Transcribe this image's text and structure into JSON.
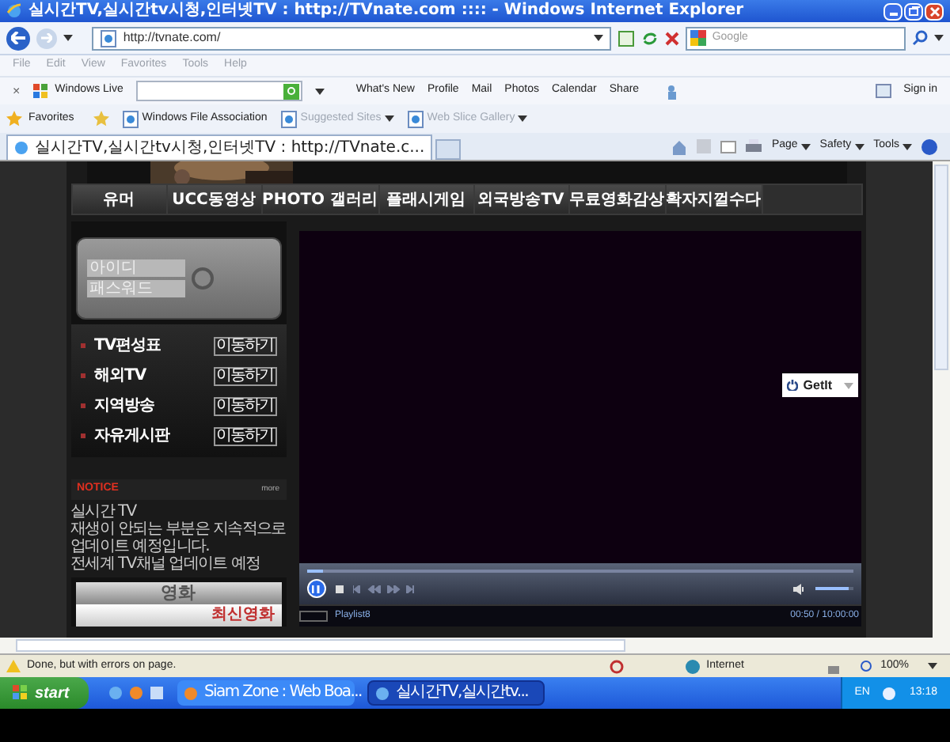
{
  "window": {
    "title": "실시간TV,실시간tv시청,인터넷TV : http://TVnate.com :::: - Windows Internet Explorer"
  },
  "address_bar": {
    "url": "http://tvnate.com/",
    "search_placeholder": "Google"
  },
  "menu_bar": [
    "File",
    "Edit",
    "View",
    "Favorites",
    "Tools",
    "Help"
  ],
  "live_toolbar": {
    "close": "×",
    "brand": "Windows Live",
    "links": [
      "What's New",
      "Profile",
      "Mail",
      "Photos",
      "Calendar",
      "Share"
    ],
    "sign_in": "Sign in"
  },
  "favorites_bar": {
    "label": "Favorites",
    "items": [
      {
        "label": "Windows File Association",
        "menu": false,
        "disabled": false
      },
      {
        "label": "Suggested Sites",
        "menu": true,
        "disabled": true
      },
      {
        "label": "Web Slice Gallery",
        "menu": true,
        "disabled": true
      }
    ]
  },
  "tabs": [
    {
      "label": "실시간TV,실시간tv시청,인터넷TV : http://TVnate.c...",
      "selected": true
    }
  ],
  "command_bar": [
    "Page",
    "Safety",
    "Tools"
  ],
  "site_nav": [
    "유머",
    "UCC동영상",
    "PHOTO 갤러리",
    "플래시게임",
    "외국방송TV",
    "무료영화감상",
    "확자지껄수다"
  ],
  "login": {
    "id_placeholder": "아이디",
    "password_placeholder": "패스워드"
  },
  "side_menu": [
    {
      "label": "TV편성표",
      "button": "이동하기"
    },
    {
      "label": "해외TV",
      "button": "이동하기"
    },
    {
      "label": "지역방송",
      "button": "이동하기"
    },
    {
      "label": "자유게시판",
      "button": "이동하기"
    }
  ],
  "notice": {
    "title": "NOTICE",
    "more": "more",
    "lines": [
      "실시간 TV",
      "재생이 안되는 부분은 지속적으로 업데이트 예정입니다.",
      "전세계 TV채널 업데이트 예정"
    ]
  },
  "movie_box": {
    "title": "영화",
    "items": [
      "최신영화"
    ]
  },
  "player": {
    "getit": "GetIt",
    "seek": {
      "level": 0.03
    },
    "volume": {
      "level": 0.9
    },
    "playing": true,
    "playlist": "Playlist8",
    "time": "00:50 / 10:00:00"
  },
  "status_bar": {
    "text": "Done, but with errors on page.",
    "zone": "Internet",
    "zoom": "100%"
  },
  "taskbar": {
    "start": "start",
    "buttons": [
      {
        "label": "Siam Zone : Web Boa...",
        "selected": false
      },
      {
        "label": "실시간TV,실시간tv...",
        "selected": true
      }
    ],
    "language": "EN",
    "clock": "13:18"
  }
}
